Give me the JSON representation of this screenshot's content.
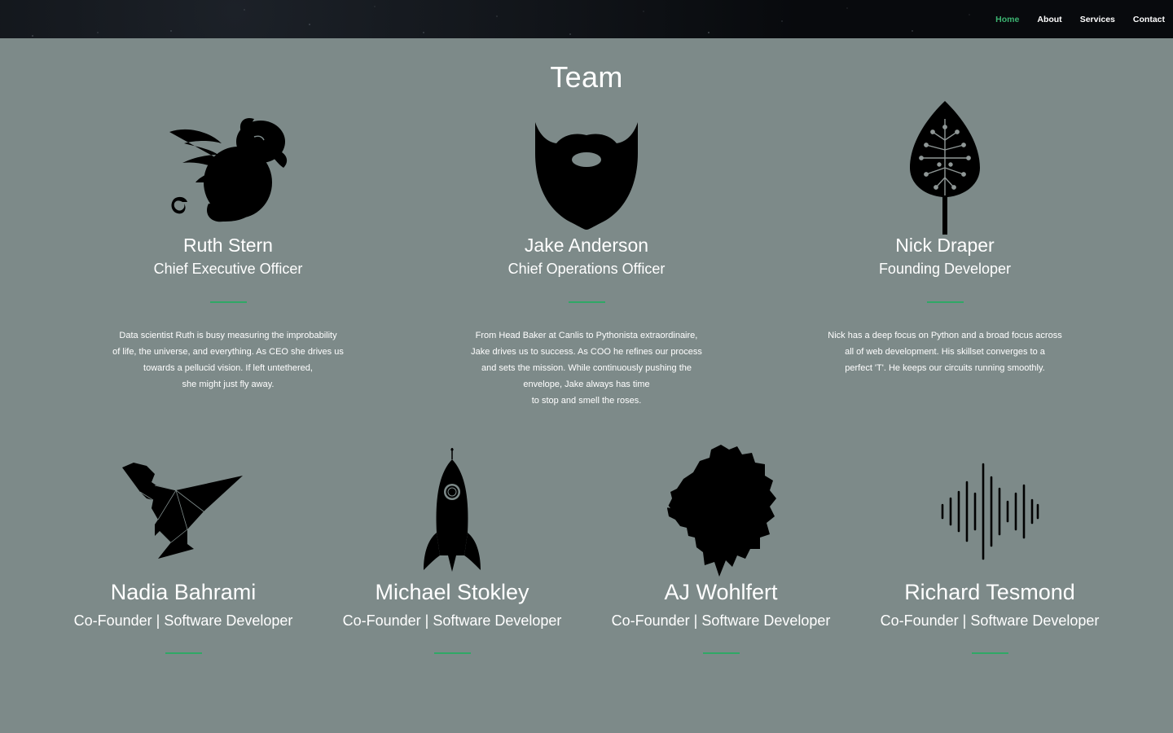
{
  "nav": {
    "links": [
      {
        "label": "Home",
        "active": true
      },
      {
        "label": "About",
        "active": false
      },
      {
        "label": "Services",
        "active": false
      },
      {
        "label": "Contact",
        "active": false
      }
    ]
  },
  "team": {
    "title": "Team",
    "leaders": [
      {
        "name": "Ruth Stern",
        "role": "Chief Executive Officer",
        "icon": "flying-rabbit-icon",
        "bio": "Data scientist Ruth is busy measuring the improbability\nof life, the universe, and everything. As CEO she drives us\ntowards a pellucid vision. If left untethered,\nshe might just fly away."
      },
      {
        "name": "Jake Anderson",
        "role": "Chief Operations Officer",
        "icon": "beard-icon",
        "bio": "From Head Baker at Canlis to Pythonista extraordinaire,\nJake drives us to success. As COO he refines our process\nand sets the mission. While continuously pushing the\nenvelope, Jake always has time\nto stop and smell the roses."
      },
      {
        "name": "Nick Draper",
        "role": "Founding Developer",
        "icon": "circuit-leaf-icon",
        "bio": "Nick has a deep focus on Python and a broad focus across\nall of web development. His skillset converges to a\nperfect 'T'. He keeps our circuits running smoothly."
      }
    ],
    "cofounders": [
      {
        "name": "Nadia Bahrami",
        "role": "Co-Founder | Software Developer",
        "icon": "origami-dinosaur-icon"
      },
      {
        "name": "Michael Stokley",
        "role": "Co-Founder | Software Developer",
        "icon": "rocket-icon"
      },
      {
        "name": "AJ Wohlfert",
        "role": "Co-Founder | Software Developer",
        "icon": "lion-icon"
      },
      {
        "name": "Richard Tesmond",
        "role": "Co-Founder | Software Developer",
        "icon": "sound-wave-icon"
      }
    ]
  },
  "colors": {
    "background": "#7d8a89",
    "accent": "#2fa866",
    "nav_active": "#3cb371"
  }
}
